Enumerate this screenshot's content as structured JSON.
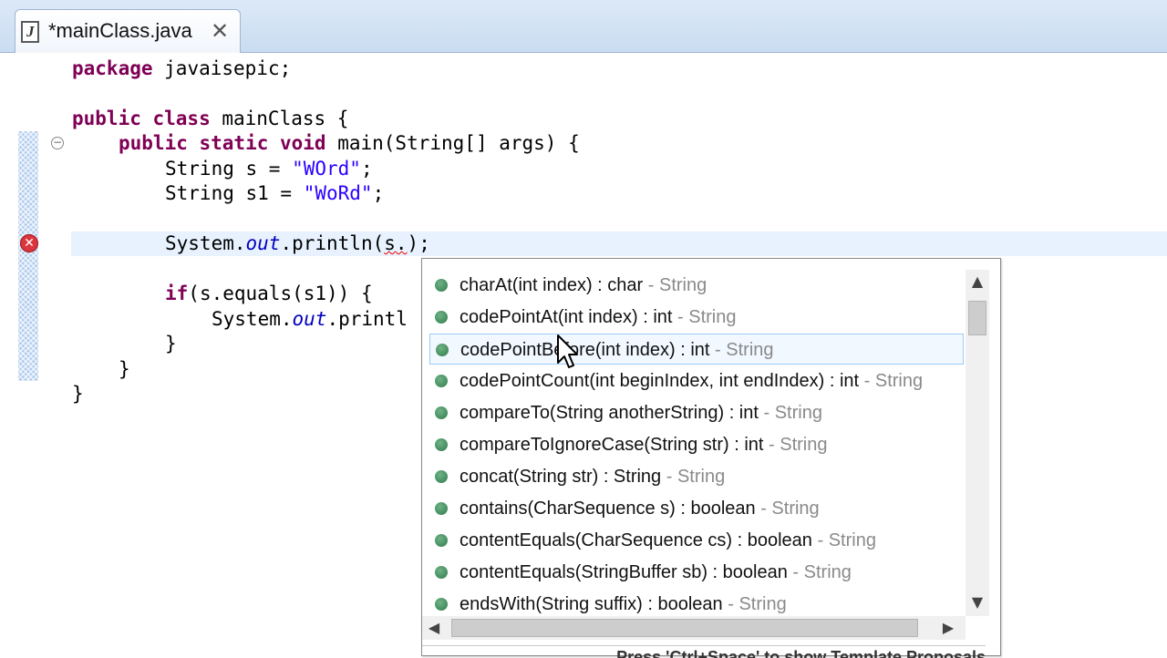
{
  "tab": {
    "icon": "java-file-icon",
    "title": "*mainClass.java",
    "close_icon": "close-icon"
  },
  "editor": {
    "lines": {
      "l1": {
        "kw": "package",
        "rest": " javaisepic;"
      },
      "l2": {
        "kw": "public class",
        "rest": " mainClass {"
      },
      "l3": {
        "kw": "public static void",
        "rest": " main(String[] args) {"
      },
      "l4": {
        "pre": "String s = ",
        "str": "\"WOrd\"",
        "post": ";"
      },
      "l5": {
        "pre": "String s1 = ",
        "str": "\"WoRd\"",
        "post": ";"
      },
      "l6": {
        "pre": "System.",
        "fld": "out",
        "mid": ".println(",
        "err": "s.",
        "post": ");"
      },
      "l7": {
        "kw": "if",
        "rest": "(s.equals(s1)) {"
      },
      "l8": {
        "pre": "System.",
        "fld": "out",
        "mid": ".printl"
      },
      "l9": "}",
      "l10": "}",
      "l11": "}"
    },
    "fold_icon": "collapse-icon",
    "error_icon": "error-icon"
  },
  "completion": {
    "items": [
      {
        "sig": "charAt(int index) : char",
        "owner": " - String"
      },
      {
        "sig": "codePointAt(int index) : int",
        "owner": " - String"
      },
      {
        "sig": "codePointBefore(int index) : int",
        "owner": " - String"
      },
      {
        "sig": "codePointCount(int beginIndex, int endIndex) : int",
        "owner": " - String"
      },
      {
        "sig": "compareTo(String anotherString) : int",
        "owner": " - String"
      },
      {
        "sig": "compareToIgnoreCase(String str) : int",
        "owner": " - String"
      },
      {
        "sig": "concat(String str) : String",
        "owner": " - String"
      },
      {
        "sig": "contains(CharSequence s) : boolean",
        "owner": " - String"
      },
      {
        "sig": "contentEquals(CharSequence cs) : boolean",
        "owner": " - String"
      },
      {
        "sig": "contentEquals(StringBuffer sb) : boolean",
        "owner": " - String"
      },
      {
        "sig": "endsWith(String suffix) : boolean",
        "owner": " - String"
      }
    ],
    "selected_index": 2,
    "hint": "Press 'Ctrl+Space' to show Template Proposals",
    "scroll": {
      "up": "▲",
      "down": "▼",
      "left": "◀",
      "right": "▶"
    }
  },
  "colors": {
    "keyword": "#7f0055",
    "string": "#2a00ff",
    "field": "#0000c0",
    "method_dot": "#3f8a5a"
  }
}
